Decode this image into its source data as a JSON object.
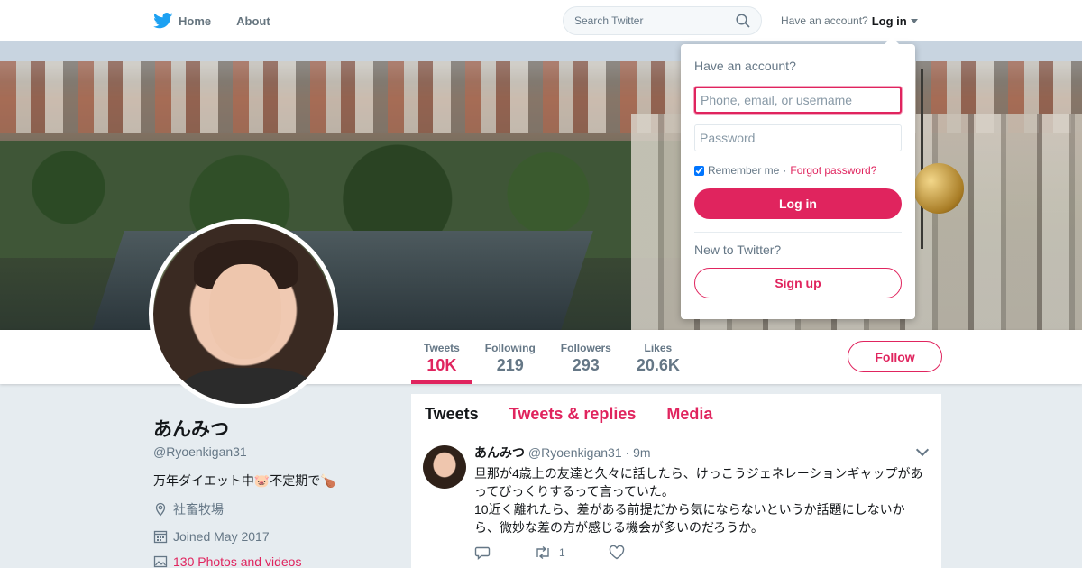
{
  "nav": {
    "home_label": "Home",
    "about_label": "About",
    "search_placeholder": "Search Twitter",
    "account_prompt": "Have an account?",
    "login_label": "Log in"
  },
  "stats": [
    {
      "label": "Tweets",
      "value": "10K"
    },
    {
      "label": "Following",
      "value": "219"
    },
    {
      "label": "Followers",
      "value": "293"
    },
    {
      "label": "Likes",
      "value": "20.6K"
    }
  ],
  "follow_label": "Follow",
  "profile": {
    "name": "あんみつ",
    "handle": "@Ryoenkigan31",
    "bio": "万年ダイエット中🐷不定期で🍗",
    "location": "社畜牧場",
    "joined": "Joined May 2017",
    "media_link": "130 Photos and videos"
  },
  "timeline": {
    "tabs": [
      "Tweets",
      "Tweets & replies",
      "Media"
    ],
    "tweet": {
      "name": "あんみつ",
      "handle": "@Ryoenkigan31",
      "time": "· 9m",
      "text_line1": "旦那が4歳上の友達と久々に話したら、けっこうジェネレーションギャップがあってびっくりするって言っていた。",
      "text_line2": "10近く離れたら、差がある前提だから気にならないというか話題にしないから、微妙な差の方が感じる機会が多いのだろうか。",
      "retweets": "1"
    }
  },
  "login": {
    "title": "Have an account?",
    "username_placeholder": "Phone, email, or username",
    "password_placeholder": "Password",
    "remember": "Remember me",
    "separator": "·",
    "forgot": "Forgot password?",
    "button": "Log in",
    "new_prompt": "New to Twitter?",
    "signup": "Sign up"
  },
  "colors": {
    "accent": "#e0245e",
    "muted": "#657786",
    "background": "#e6ecf0",
    "bird_blue": "#1da1f2"
  },
  "icons": [
    "twitter-bird-icon",
    "search-icon",
    "caret-down-icon",
    "location-icon",
    "calendar-icon",
    "media-icon",
    "reply-icon",
    "retweet-icon",
    "like-icon",
    "chevron-down-icon"
  ]
}
